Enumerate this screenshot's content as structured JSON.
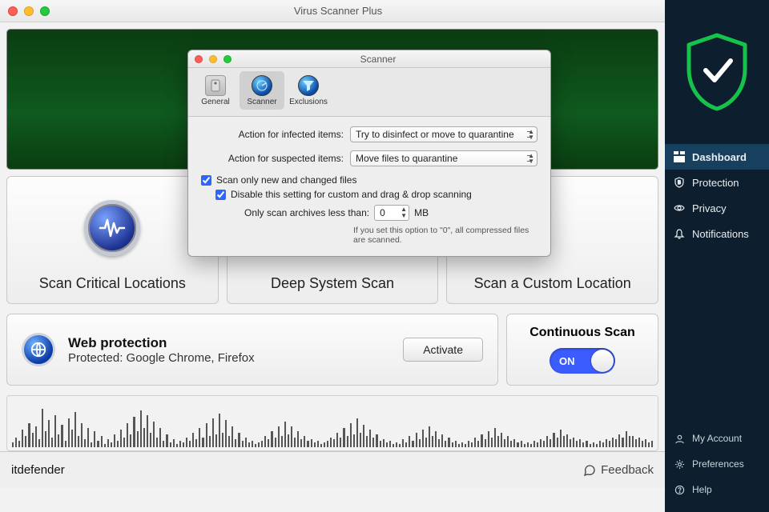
{
  "window": {
    "title": "Virus Scanner Plus"
  },
  "tiles": [
    {
      "label": "Scan Critical Locations"
    },
    {
      "label": "Deep System Scan"
    },
    {
      "label": "Scan a Custom Location"
    }
  ],
  "web_protection": {
    "title": "Web protection",
    "subtitle": "Protected: Google Chrome, Firefox",
    "button": "Activate"
  },
  "continuous_scan": {
    "title": "Continuous Scan",
    "toggle_label": "ON"
  },
  "footer": {
    "brand": "itdefender",
    "feedback": "Feedback"
  },
  "dialog": {
    "title": "Scanner",
    "tabs": {
      "general": "General",
      "scanner": "Scanner",
      "exclusions": "Exclusions"
    },
    "infected_label": "Action for infected items:",
    "infected_value": "Try to disinfect or move to quarantine",
    "suspected_label": "Action for suspected items:",
    "suspected_value": "Move files to quarantine",
    "chk_new_changed": "Scan only new and changed files",
    "chk_disable_custom": "Disable this setting for custom and drag & drop scanning",
    "archives_label": "Only scan archives less than:",
    "archives_value": "0",
    "archives_unit": "MB",
    "archives_hint": "If you set this option to \"0\", all compressed files are scanned."
  },
  "sidebar": {
    "nav": [
      {
        "label": "Dashboard"
      },
      {
        "label": "Protection"
      },
      {
        "label": "Privacy"
      },
      {
        "label": "Notifications"
      }
    ],
    "bottom": [
      {
        "label": "My Account"
      },
      {
        "label": "Preferences"
      },
      {
        "label": "Help"
      }
    ]
  },
  "waveform": [
    6,
    12,
    8,
    22,
    14,
    30,
    18,
    26,
    10,
    48,
    20,
    34,
    12,
    40,
    16,
    28,
    8,
    36,
    22,
    44,
    14,
    30,
    10,
    24,
    6,
    20,
    8,
    14,
    4,
    10,
    6,
    16,
    8,
    22,
    12,
    30,
    16,
    38,
    20,
    46,
    24,
    40,
    18,
    32,
    12,
    24,
    8,
    16,
    6,
    10,
    4,
    8,
    6,
    12,
    8,
    18,
    10,
    24,
    12,
    30,
    14,
    36,
    16,
    42,
    18,
    34,
    14,
    26,
    10,
    18,
    8,
    12,
    6,
    8,
    4,
    6,
    8,
    14,
    10,
    20,
    12,
    26,
    14,
    32,
    16,
    26,
    12,
    20,
    10,
    14,
    8,
    10,
    6,
    8,
    4,
    6,
    8,
    12,
    10,
    18,
    12,
    24,
    14,
    30,
    16,
    36,
    18,
    28,
    14,
    22,
    12,
    16,
    8,
    10,
    6,
    8,
    4,
    6,
    4,
    10,
    6,
    14,
    8,
    18,
    10,
    22,
    12,
    26,
    14,
    20,
    10,
    16,
    8,
    12,
    6,
    8,
    4,
    6,
    4,
    8,
    6,
    12,
    8,
    16,
    10,
    20,
    12,
    24,
    14,
    18,
    10,
    14,
    8,
    10,
    6,
    8,
    4,
    6,
    4,
    8,
    6,
    10,
    8,
    14,
    10,
    18,
    12,
    22,
    14,
    16,
    10,
    12,
    8,
    10,
    6,
    8,
    4,
    6,
    4,
    8,
    6,
    10,
    8,
    12,
    10,
    16,
    12,
    20,
    14,
    14,
    10,
    12,
    8,
    10,
    6,
    8
  ]
}
